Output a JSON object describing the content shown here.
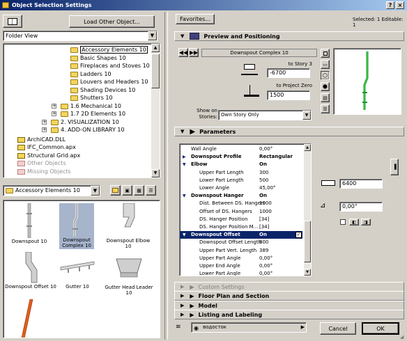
{
  "window": {
    "title": "Object Selection Settings",
    "selected_info": "Selected: 1 Editable: 1"
  },
  "left": {
    "load_button": "Load Other Object...",
    "view_select": "Folder View",
    "tree": [
      {
        "label": "Accessory Elements 10",
        "indent": 2,
        "selected": true
      },
      {
        "label": "Basic Shapes 10",
        "indent": 2
      },
      {
        "label": "Fireplaces and Stoves 10",
        "indent": 2
      },
      {
        "label": "Ladders 10",
        "indent": 2
      },
      {
        "label": "Louvers and Headers 10",
        "indent": 2
      },
      {
        "label": "Shading Devices 10",
        "indent": 2
      },
      {
        "label": "Shutters 10",
        "indent": 2
      },
      {
        "label": "1.6 Mechanical 10",
        "indent": 1,
        "expander": "+"
      },
      {
        "label": "1.7 2D Elements 10",
        "indent": 1,
        "expander": "+"
      },
      {
        "label": "2. VISUALIZATION 10",
        "indent": 0,
        "expander": "+"
      },
      {
        "label": "4. ADD-ON LIBRARY 10",
        "indent": 0,
        "expander": "+"
      }
    ],
    "files": [
      {
        "label": "ArchiCAD.DLL"
      },
      {
        "label": "IFC_Common.apx"
      },
      {
        "label": "Structural Grid.apx"
      },
      {
        "label": "Other Objects",
        "muted": true
      },
      {
        "label": "Missing Objects",
        "muted": true
      }
    ],
    "current_folder": "Accessory Elements 10",
    "thumbs": [
      {
        "label": "Downspout 10"
      },
      {
        "label": "Downspout Complex 10",
        "selected": true
      },
      {
        "label": "Downspout Elbow 10"
      },
      {
        "label": "Downspout Offset 10"
      },
      {
        "label": "Gutter 10"
      },
      {
        "label": "Gutter Head Leader 10"
      },
      {
        "label": ""
      }
    ]
  },
  "right": {
    "favorites": "Favorites...",
    "preview_title": "Preview and Positioning",
    "object_name": "Downspout Complex 10",
    "to_story": "to Story 3",
    "story_value": "-6700",
    "to_zero": "to Project Zero",
    "zero_value": "1500",
    "show_on_label": "Show on Stories:",
    "show_on_value": "Own Story Only",
    "params_title": "Parameters",
    "params": [
      {
        "name": "Wall Angle",
        "value": "0,00°",
        "level": 0
      },
      {
        "name": "Downspout Profile",
        "value": "Rectangular",
        "level": 0,
        "bold": true,
        "tri": "▶"
      },
      {
        "name": "Elbow",
        "value": "On",
        "level": 0,
        "bold": true,
        "tri": "▼"
      },
      {
        "name": "Upper Part Length",
        "value": "300",
        "level": 1
      },
      {
        "name": "Lower Part Length",
        "value": "500",
        "level": 1
      },
      {
        "name": "Lower Angle",
        "value": "45,00°",
        "level": 1
      },
      {
        "name": "Downspout Hanger",
        "value": "On",
        "level": 0,
        "bold": true,
        "tri": "▼"
      },
      {
        "name": "Dist. Between DS. Hangers",
        "value": "1000",
        "level": 1
      },
      {
        "name": "Offset of DS. Hangers",
        "value": "1000",
        "level": 1
      },
      {
        "name": "DS. Hanger Position",
        "value": "[34]",
        "level": 1
      },
      {
        "name": "DS. Hanger Position M...",
        "value": "[34]",
        "level": 1
      },
      {
        "name": "Downspout Offset",
        "value": "On",
        "level": 0,
        "bold": true,
        "tri": "▼",
        "selected": true
      },
      {
        "name": "Downspout Offset Length",
        "value": "800",
        "level": 1
      },
      {
        "name": "Upper Part Vert. Length",
        "value": "389",
        "level": 1
      },
      {
        "name": "Upper Part Angle",
        "value": "0,00°",
        "level": 1
      },
      {
        "name": "Upper End Angle",
        "value": "0,00°",
        "level": 1
      },
      {
        "name": "Lower Part Angle",
        "value": "0,00°",
        "level": 1
      }
    ],
    "height_value": "6400",
    "angle_value": "0,00°",
    "sections": [
      {
        "label": "Custom Settings",
        "disabled": true
      },
      {
        "label": "Floor Plan and Section"
      },
      {
        "label": "Model"
      },
      {
        "label": "Listing and Labeling"
      }
    ],
    "layer": "водосток",
    "cancel": "Cancel",
    "ok": "OK"
  }
}
